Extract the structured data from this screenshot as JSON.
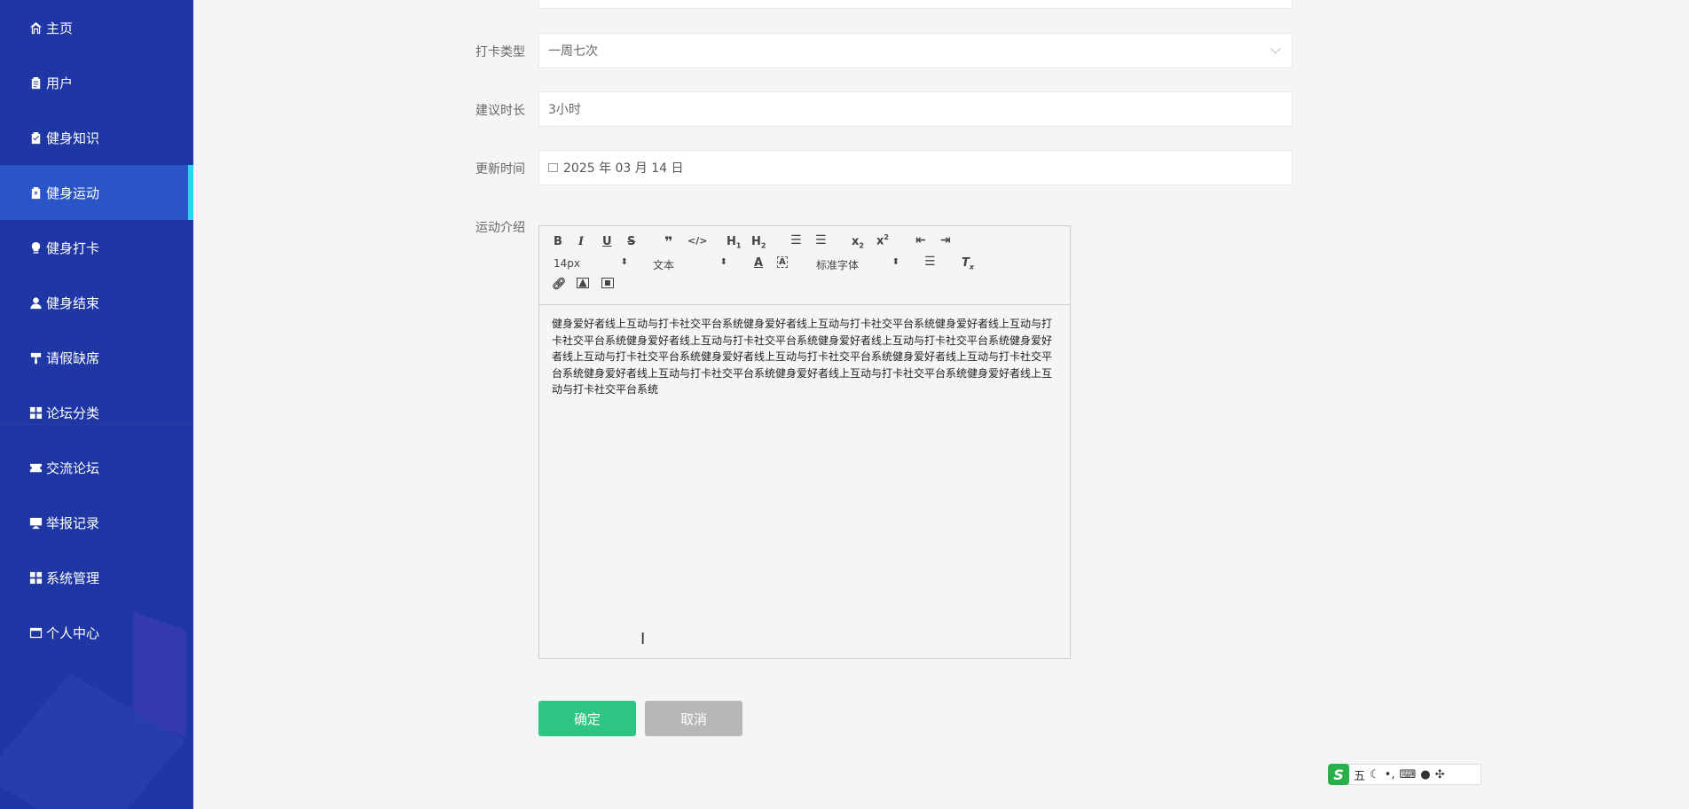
{
  "sidebar": {
    "items": [
      {
        "label": "主页",
        "icon": "home-icon"
      },
      {
        "label": "用户",
        "icon": "clipboard-icon"
      },
      {
        "label": "健身知识",
        "icon": "clipboard-check-icon"
      },
      {
        "label": "健身运动",
        "icon": "clipboard-x-icon",
        "active": true
      },
      {
        "label": "健身打卡",
        "icon": "lightbulb-icon"
      },
      {
        "label": "健身结束",
        "icon": "user-icon"
      },
      {
        "label": "请假缺席",
        "icon": "paint-roller-icon"
      },
      {
        "label": "论坛分类",
        "icon": "grid-icon"
      },
      {
        "label": "交流论坛",
        "icon": "ticket-icon"
      },
      {
        "label": "举报记录",
        "icon": "monitor-icon"
      },
      {
        "label": "系统管理",
        "icon": "grid-icon"
      },
      {
        "label": "个人中心",
        "icon": "window-icon"
      }
    ],
    "colors": {
      "background": "#1f37a5",
      "active": "#2a55c9",
      "active_marker": "#2ad6ee"
    }
  },
  "form": {
    "checkin_type": {
      "label": "打卡类型",
      "value": "一周七次"
    },
    "suggested_duration": {
      "label": "建议时长",
      "value": "3小时"
    },
    "update_time": {
      "label": "更新时间",
      "value": "2025 年 03 月 14 日"
    },
    "intro": {
      "label": "运动介绍"
    }
  },
  "editor": {
    "font_size": "14px",
    "paragraph": "文本",
    "font_family": "标准字体",
    "content": "健身爱好者线上互动与打卡社交平台系统健身爱好者线上互动与打卡社交平台系统健身爱好者线上互动与打卡社交平台系统健身爱好者线上互动与打卡社交平台系统健身爱好者线上互动与打卡社交平台系统健身爱好者线上互动与打卡社交平台系统健身爱好者线上互动与打卡社交平台系统健身爱好者线上互动与打卡社交平台系统健身爱好者线上互动与打卡社交平台系统健身爱好者线上互动与打卡社交平台系统健身爱好者线上互动与打卡社交平台系统"
  },
  "buttons": {
    "confirm": "确定",
    "cancel": "取消",
    "confirm_color": "#2ec481",
    "cancel_color": "#b7b7b7"
  },
  "ime": {
    "logo": "S",
    "mode": "五"
  }
}
